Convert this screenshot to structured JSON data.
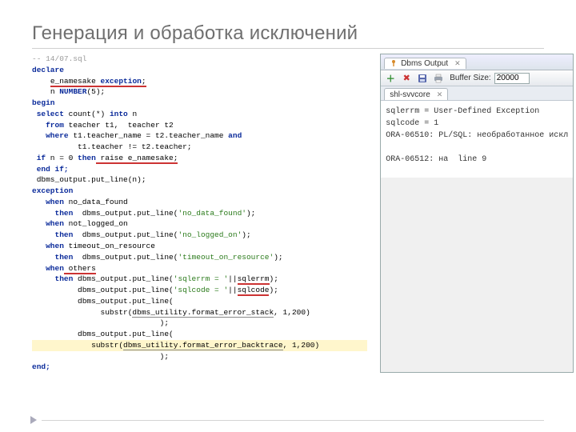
{
  "title": "Генерация и обработка исключений",
  "code": {
    "l01": "-- 14/07.sql",
    "l02a": "declare",
    "l03a": "e_namesake",
    "l03b": "exception",
    "l04a": "n ",
    "l04b": "NUMBER",
    "l04c": "(5);",
    "l05": "begin",
    "l06a": "select",
    "l06b": " count(*) ",
    "l06c": "into",
    "l06d": " n",
    "l07a": "from",
    "l07b": " teacher t1,  teacher t2",
    "l08a": "where",
    "l08b": " t1.teacher_name = t2.teacher_name ",
    "l08c": "and",
    "l09": "          t1.teacher != t2.teacher;",
    "l10a": "if",
    "l10b": " n = 0 ",
    "l10c": "then",
    "l10d": " raise e_namesake;",
    "l11": "end if;",
    "l12": " dbms_output.put_line(n);",
    "l13": "exception",
    "l14a": "when",
    "l14b": " no_data_found",
    "l15a": "then",
    "l15b": "  dbms_output.put_line(",
    "l15c": "'no_data_found'",
    "l15d": ");",
    "l16a": "when",
    "l16b": " not_logged_on",
    "l17a": "then",
    "l17b": "  dbms_output.put_line(",
    "l17c": "'no_logged_on'",
    "l17d": ");",
    "l18a": "when",
    "l18b": " timeout_on_resource",
    "l19a": "then",
    "l19b": "  dbms_output.put_line(",
    "l19c": "'timeout_on_resource'",
    "l19d": ");",
    "l20a": "when",
    "l20b": " others",
    "l21a": "then",
    "l21b": " dbms_output.put_line(",
    "l21c": "'sqlerrm = '",
    "l21d": "||",
    "l21e": "sqlerrm",
    "l21f": ");",
    "l22a": "          dbms_output.put_line(",
    "l22b": "'sqlcode = '",
    "l22c": "||",
    "l22d": "sqlcode",
    "l22e": ");",
    "l23": "          dbms_output.put_line(",
    "l24a": "               substr(",
    "l24b": "dbms_utility.format_error_stack",
    "l24c": ", 1,200)",
    "l25": "                            );",
    "l26": "          dbms_output.put_line(",
    "l27a": "             substr(",
    "l27b": "dbms_utility.format_error_backtrace",
    "l27c": ", 1,200)",
    "l28": "                            );",
    "l29": "end;"
  },
  "output": {
    "tab_title": "Dbms Output",
    "buffer_label": "Buffer Size:",
    "buffer_value": "20000",
    "conn_tab": "shl-svvcore",
    "line1": "sqlerrm = User-Defined Exception",
    "line2": "sqlcode = 1",
    "line3": "ORA-06510: PL/SQL: необработанное искл",
    "line4": "",
    "line5": "ORA-06512: на  line 9"
  }
}
